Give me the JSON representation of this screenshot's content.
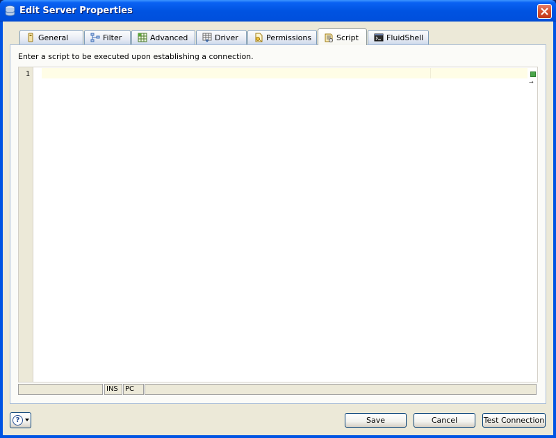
{
  "window": {
    "title": "Edit Server Properties",
    "icons": {
      "app": "server-icon",
      "close": "close-icon"
    }
  },
  "tabs": [
    {
      "label": "General",
      "icon": "general-icon",
      "active": false
    },
    {
      "label": "Filter",
      "icon": "filter-icon",
      "active": false
    },
    {
      "label": "Advanced",
      "icon": "advanced-icon",
      "active": false
    },
    {
      "label": "Driver",
      "icon": "driver-icon",
      "active": false
    },
    {
      "label": "Permissions",
      "icon": "permissions-icon",
      "active": false
    },
    {
      "label": "Script",
      "icon": "script-icon",
      "active": true
    },
    {
      "label": "FluidShell",
      "icon": "fluidshell-icon",
      "active": false
    }
  ],
  "panel": {
    "description": "Enter a script to be executed upon establishing a connection."
  },
  "editor": {
    "line_numbers": [
      "1"
    ],
    "content": "",
    "status": {
      "position": "",
      "mode": "INS",
      "encoding": "PC",
      "message": ""
    }
  },
  "buttons": {
    "help_icon": "help-icon",
    "save": "Save",
    "cancel": "Cancel",
    "test_connection": "Test Connection"
  },
  "colors": {
    "title_bar": "#0054e3",
    "client": "#ece9d8",
    "current_line": "#fffde6",
    "overview_marker": "#4aa64a"
  }
}
